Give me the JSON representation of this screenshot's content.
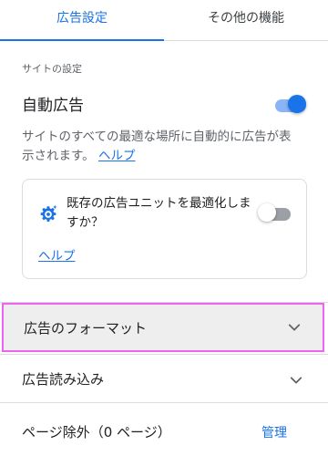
{
  "tabs": [
    {
      "label": "広告設定",
      "active": true
    },
    {
      "label": "その他の機能",
      "active": false
    }
  ],
  "site_settings": {
    "section_label": "サイトの設定",
    "auto_ads": {
      "title": "自動広告",
      "enabled": true,
      "description": "サイトのすべての最適な場所に自動的に広告が表示されます。",
      "help_link": "ヘルプ"
    },
    "optimize_card": {
      "icon": "gear-sparkle-icon",
      "text": "既存の広告ユニットを最適化しますか？",
      "enabled": false,
      "help_link": "ヘルプ"
    }
  },
  "sections": {
    "ad_formats": {
      "label": "広告のフォーマット",
      "icon": "chevron-down-icon"
    },
    "ad_load": {
      "label": "広告読み込み",
      "icon": "chevron-down-icon"
    },
    "page_exclusions": {
      "label": "ページ除外（0 ページ）",
      "action": "管理"
    }
  },
  "colors": {
    "accent": "#1a73e8",
    "highlight_border": "#f062f0"
  }
}
